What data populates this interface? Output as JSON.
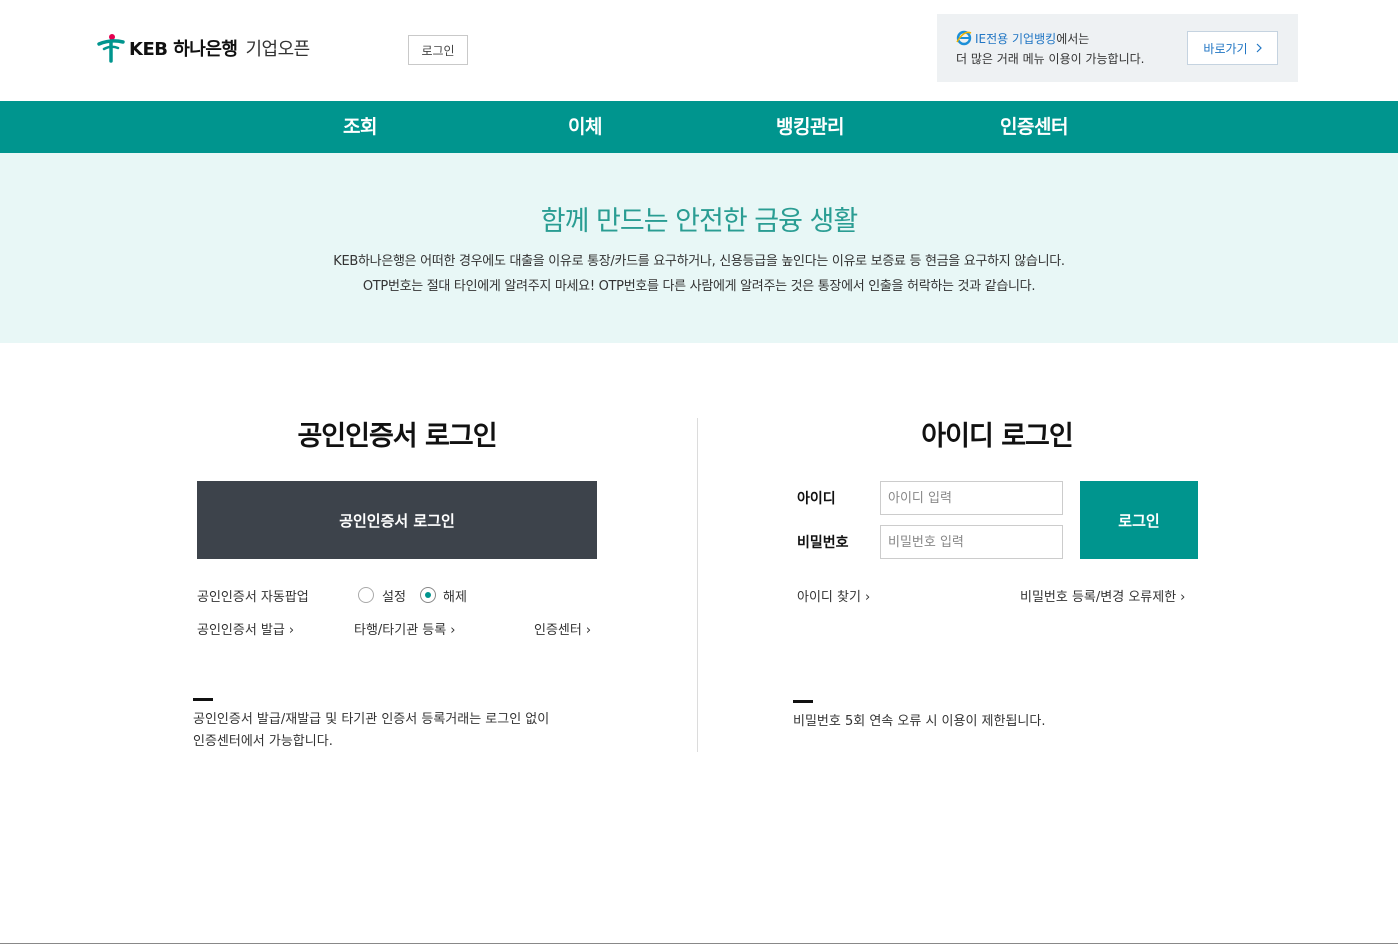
{
  "header": {
    "logo_brand": "KEB 하나은행",
    "logo_sub": "기업오픈",
    "login_button": "로그인",
    "ie_notice": {
      "highlight": "IE전용 기업뱅킹",
      "line1_rest": "에서는",
      "line2": "더 많은 거래 메뉴 이용이 가능합니다.",
      "go_button": "바로가기"
    }
  },
  "nav": {
    "items": [
      "조회",
      "이체",
      "뱅킹관리",
      "인증센터"
    ]
  },
  "banner": {
    "title": "함께 만드는 안전한 금융 생활",
    "line1": "KEB하나은행은 어떠한 경우에도 대출을 이유로 통장/카드를 요구하거나, 신용등급을 높인다는 이유로 보증료 등 현금을 요구하지 않습니다.",
    "line2": "OTP번호는 절대 타인에게 알려주지 마세요! OTP번호를 다른 사람에게 알려주는 것은 통장에서 인출을 허락하는 것과 같습니다."
  },
  "cert_login": {
    "title": "공인인증서 로그인",
    "button": "공인인증서 로그인",
    "auto_popup_label": "공인인증서 자동팝업",
    "option_on": "설정",
    "option_off": "해제",
    "selected": "해제",
    "links": [
      "공인인증서 발급",
      "타행/타기관 등록",
      "인증센터"
    ],
    "notice_line1": "공인인증서 발급/재발급 및 타기관 인증서 등록거래는 로그인 없이",
    "notice_line2": "인증센터에서 가능합니다."
  },
  "id_login": {
    "title": "아이디 로그인",
    "id_label": "아이디",
    "id_placeholder": "아이디 입력",
    "pw_label": "비밀번호",
    "pw_placeholder": "비밀번호 입력",
    "button": "로그인",
    "links": [
      "아이디 찾기",
      "비밀번호 등록/변경 오류제한"
    ],
    "notice": "비밀번호 5회 연속 오류 시 이용이 제한됩니다."
  },
  "colors": {
    "brand_teal": "#00958e",
    "banner_bg": "#e8f7f6",
    "cert_button": "#3d434b",
    "link_blue": "#2176c4"
  },
  "icons": {
    "logo": "hana-logo-icon",
    "ie": "ie-browser-icon",
    "chevron": "chevron-right-icon"
  }
}
